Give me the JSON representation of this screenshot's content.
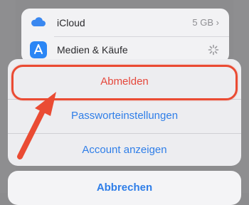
{
  "settings": {
    "icloud_label": "iCloud",
    "icloud_value": "5 GB",
    "media_label": "Medien & Käufe"
  },
  "sheet": {
    "signout_label": "Abmelden",
    "password_label": "Passworteinstellungen",
    "account_label": "Account anzeigen",
    "cancel_label": "Abbrechen"
  },
  "colors": {
    "accent_blue": "#2f7ee8",
    "destructive_red": "#e5483c",
    "annotation_red": "#ea4b33"
  },
  "icons": [
    "cloud-icon",
    "app-store-icon",
    "chevron-right-icon",
    "loading-spinner-icon",
    "annotation-arrow-icon"
  ]
}
